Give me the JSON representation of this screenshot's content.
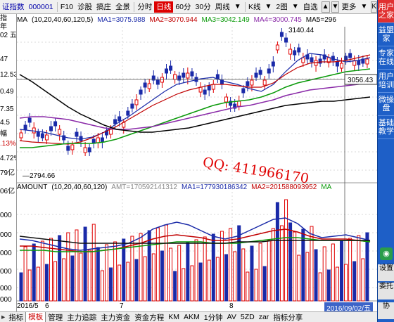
{
  "toolbar": {
    "symbol": "证指数",
    "code": "000001",
    "items": [
      "F10",
      "诊股",
      "搞庄",
      "全景"
    ],
    "periods": [
      "分时",
      "日线",
      "60分",
      "30分",
      "周线"
    ],
    "active_period": "日线",
    "kline_mode": "K线",
    "layout": "2图",
    "restore": "自选",
    "more": "更多"
  },
  "left_axis": {
    "labels": [
      "指",
      "年",
      "02 五",
      "47",
      "12.53",
      "0.49",
      "7.35",
      "4.5",
      "幅",
      ".13%",
      "4.72%",
      "79亿",
      "06亿",
      "000",
      "000",
      "000",
      "000",
      "000",
      "000"
    ]
  },
  "kline_legend": {
    "ma_head": "MA",
    "params": "(10,20,40,60,120,5)",
    "ma1": "MA1=3075.988",
    "ma2": "MA2=3070.944",
    "ma3": "MA3=3042.149",
    "ma4": "MA4=3000.745",
    "ma5": "MA5=296"
  },
  "kline_annotations": {
    "high": "3140.44",
    "low": "2794.66",
    "crosshair_price": "3056.43"
  },
  "volume_legend": {
    "head": "AMOUNT",
    "params": "(10,20,40,60,120)",
    "amt": "AMT=170592141312",
    "ma1": "MA1=177930186342",
    "ma2": "MA2=201588093952",
    "ma3": "MA"
  },
  "watermark": "QQ: 411966170",
  "date_axis": {
    "labels": [
      "2016/5",
      "6",
      "7",
      "8"
    ],
    "current_date": "2016/09/02/五"
  },
  "tabs": {
    "items": [
      "指标",
      "模板",
      "管理",
      "主力追踪",
      "主力资金",
      "资金方程",
      "KM",
      "AKM",
      "1分钟",
      "AV",
      "5ZD",
      "zar",
      "指标分享"
    ],
    "active": "模板"
  },
  "sidebar": {
    "items": [
      "用户之家",
      "益盟家",
      "专家在线",
      "用户培训",
      "微操盘",
      "基础教学"
    ],
    "bottom": [
      "设置",
      "委托",
      "协"
    ]
  },
  "colors": {
    "up": "#e00000",
    "down": "#1a2aa8",
    "ma1": "#1a2aa8",
    "ma2": "#c00000",
    "ma3": "#0a9a0a",
    "ma4": "#8a2aa8",
    "ma5": "#000000",
    "sidebar": "#1e5fc7"
  }
}
